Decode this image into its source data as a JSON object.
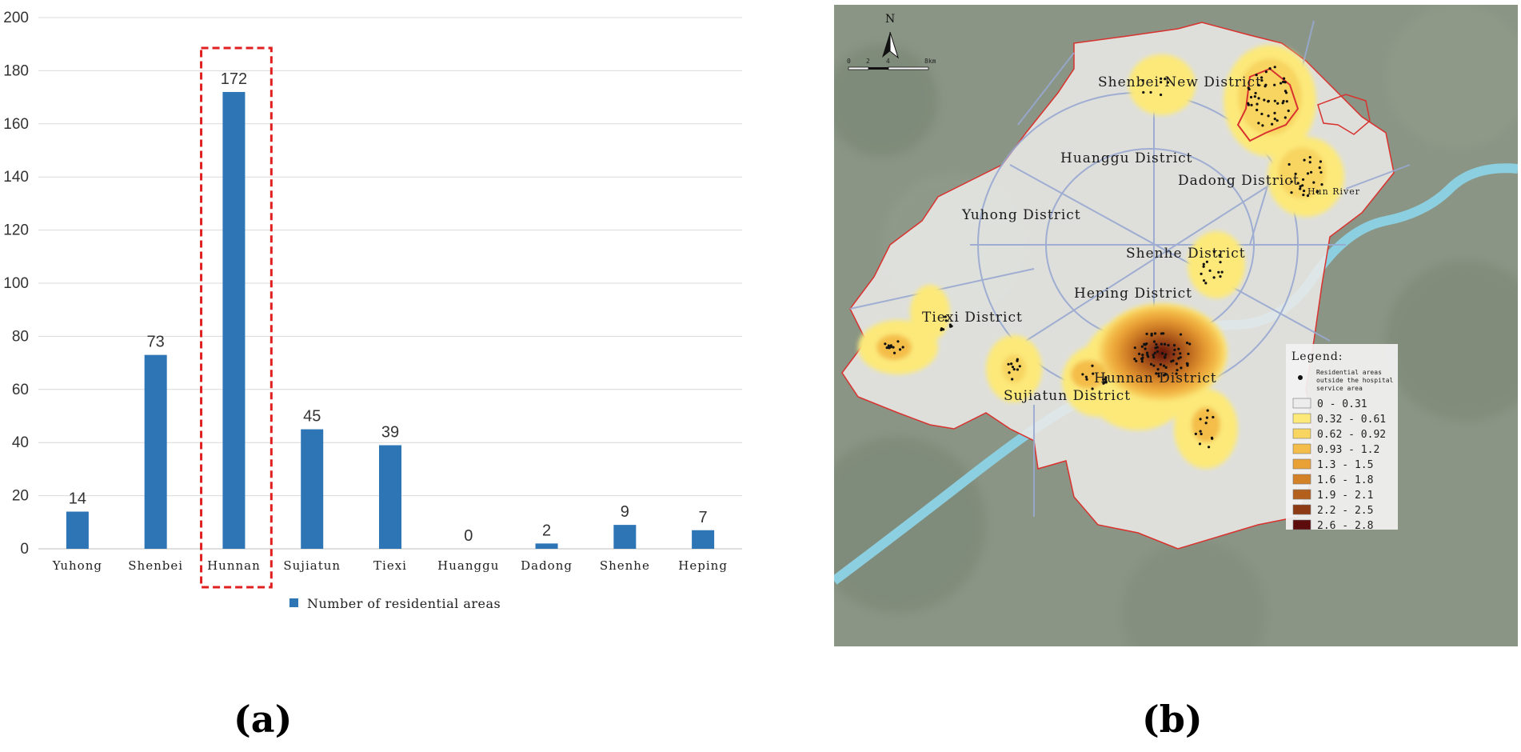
{
  "chart_data": {
    "type": "bar",
    "categories": [
      "Yuhong",
      "Shenbei",
      "Hunnan",
      "Sujiatun",
      "Tiexi",
      "Huanggu",
      "Dadong",
      "Shenhe",
      "Heping"
    ],
    "series": [
      {
        "name": "Number of residential areas",
        "values": [
          14,
          73,
          172,
          45,
          39,
          0,
          2,
          9,
          7
        ]
      }
    ],
    "ylim": [
      0,
      200
    ],
    "yticks": [
      0,
      20,
      40,
      60,
      80,
      100,
      120,
      140,
      160,
      180,
      200
    ],
    "highlighted_category": "Hunnan",
    "bar_color": "#2e75b6",
    "highlight_color": "#e02020",
    "grid": true,
    "legend_position": "bottom"
  },
  "map": {
    "north_label": "N",
    "scale_labels": [
      "0",
      "2",
      "4",
      "8km"
    ],
    "districts": {
      "shenbei": "Shenbei New District",
      "huanggu": "Huanggu District",
      "dadong": "Dadong District",
      "hun_river": "Hun River",
      "yuhong": "Yuhong District",
      "shenhe": "Shenhe District",
      "heping": "Heping District",
      "tiexi": "Tiexi District",
      "hunnan": "Hunnan District",
      "sujiatun": "Sujiatun District"
    },
    "legend": {
      "title": "Legend:",
      "dot_label_1": "Residential areas",
      "dot_label_2": "outside the hospital",
      "dot_label_3": "service area",
      "classes": [
        {
          "label": "0 - 0.31",
          "color": "#ececec"
        },
        {
          "label": "0.32 - 0.61",
          "color": "#fce97a"
        },
        {
          "label": "0.62 - 0.92",
          "color": "#f8d460"
        },
        {
          "label": "0.93 - 1.2",
          "color": "#f4bd4a"
        },
        {
          "label": "1.3 - 1.5",
          "color": "#e9a035"
        },
        {
          "label": "1.6 - 1.8",
          "color": "#d38228"
        },
        {
          "label": "1.9 - 2.1",
          "color": "#b4601d"
        },
        {
          "label": "2.2 - 2.5",
          "color": "#8e3a14"
        },
        {
          "label": "2.6 - 2.8",
          "color": "#5c0c0c"
        }
      ]
    }
  },
  "panels": {
    "a": "(a)",
    "b": "(b)"
  }
}
